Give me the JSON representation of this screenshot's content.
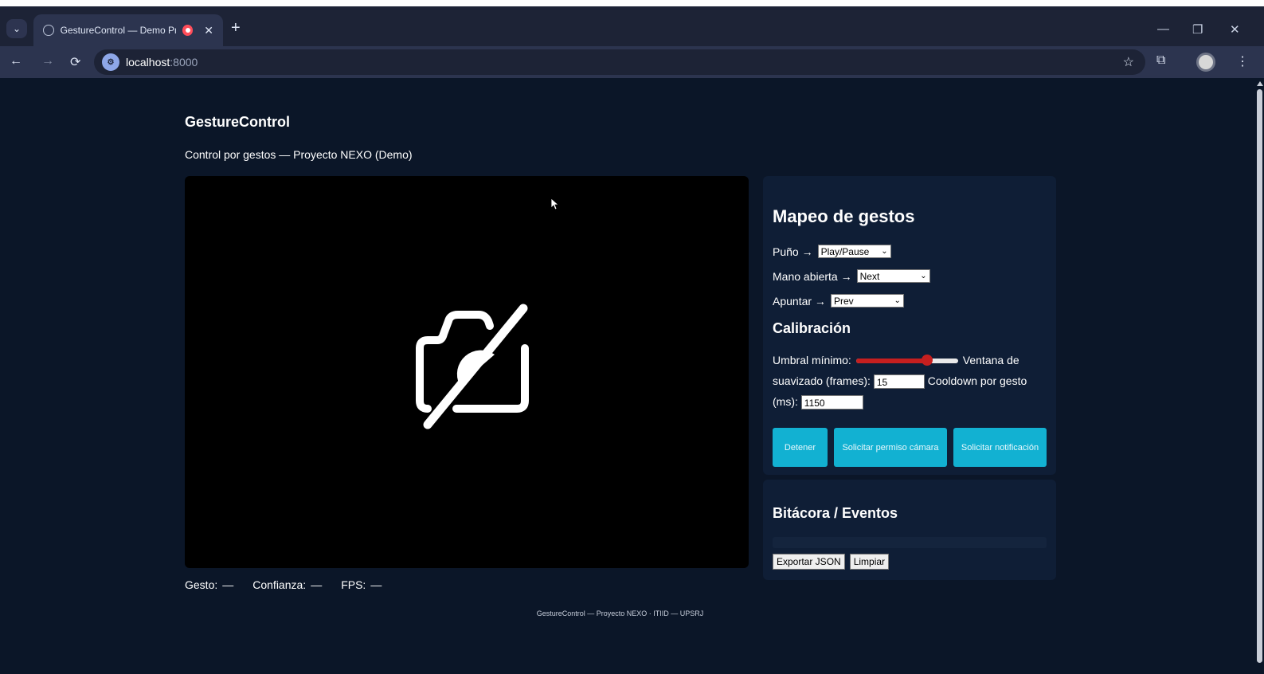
{
  "browser": {
    "tab_title": "GestureControl — Demo Pr",
    "tab_close": "✕",
    "new_tab": "+",
    "url_host": "localhost",
    "url_port": ":8000",
    "window_controls": {
      "minimize": "—",
      "restore": "❐",
      "close": "✕"
    },
    "icons": [
      "tab-list-icon",
      "globe-icon",
      "recording-icon",
      "back-icon",
      "forward-icon",
      "reload-icon",
      "site-info-icon",
      "bookmark-star-icon",
      "extensions-icon",
      "profile-icon",
      "menu-icon"
    ]
  },
  "page": {
    "title": "GestureControl",
    "subtitle": "Control por gestos — Proyecto NEXO (Demo)"
  },
  "stats": {
    "gesture_label": "Gesto:",
    "gesture_value": "—",
    "confidence_label": "Confianza:",
    "confidence_value": "—",
    "fps_label": "FPS:",
    "fps_value": "—"
  },
  "mapping": {
    "title": "Mapeo de gestos",
    "rows": [
      {
        "label": "Puño →",
        "selected": "Play/Pause"
      },
      {
        "label": "Mano abierta →",
        "selected": "Next"
      },
      {
        "label": "Apuntar →",
        "selected": "Prev"
      }
    ]
  },
  "calibration": {
    "title": "Calibración",
    "threshold_label": "Umbral mínimo:",
    "threshold_fraction": 0.7,
    "smoothing_label": "Ventana de suavizado (frames):",
    "smoothing_value": "15",
    "cooldown_label": "Cooldown por gesto (ms):",
    "cooldown_value": "1150"
  },
  "controls": {
    "stop": "Detener",
    "camera_permission": "Solicitar permiso cámara",
    "notification": "Solicitar notificación"
  },
  "log": {
    "title": "Bitácora / Eventos",
    "export": "Exportar JSON",
    "clear": "Limpiar"
  },
  "footer": "GestureControl — Proyecto NEXO · ITIID — UPSRJ",
  "colors": {
    "background": "#0b1628",
    "panel": "#0f1e36",
    "accent": "#12b1d2",
    "slider": "#c61f1f"
  }
}
